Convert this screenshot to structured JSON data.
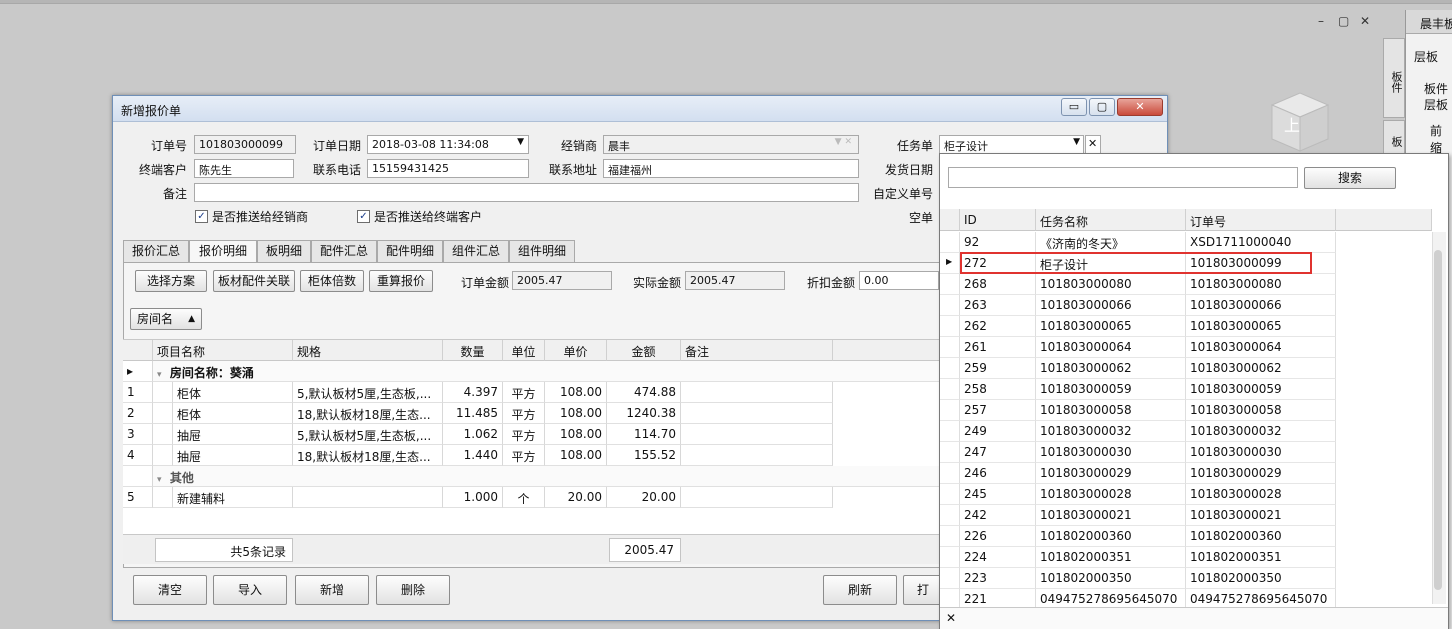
{
  "app": {
    "controls": {
      "min": "–",
      "max": "▢",
      "close": "✕"
    },
    "side_tab_1": "板件",
    "side_tab_2": "板",
    "right_panel": {
      "title": "晨丰板",
      "tab": "层板",
      "l1": "板件",
      "l2": "层板",
      "l3": "前缩"
    },
    "cube_label": "上"
  },
  "window": {
    "title": "新增报价单",
    "controls": {
      "min": "▭",
      "max": "▢",
      "close": "✕"
    },
    "form": {
      "order_no_label": "订单号",
      "order_no": "101803000099",
      "order_date_label": "订单日期",
      "order_date": "2018-03-08 11:34:08",
      "dealer_label": "经销商",
      "dealer": "晨丰",
      "task_label": "任务单",
      "task": "柜子设计",
      "customer_label": "终端客户",
      "customer": "陈先生",
      "phone_label": "联系电话",
      "phone": "15159431425",
      "address_label": "联系地址",
      "address": "福建福州",
      "ship_date_label": "发货日期",
      "remark_label": "备注",
      "remark": "",
      "custom_no_label": "自定义单号",
      "push_dealer": "是否推送给经销商",
      "push_customer": "是否推送给终端客户",
      "empty_label": "空单"
    },
    "tabs": [
      "报价汇总",
      "报价明细",
      "板明细",
      "配件汇总",
      "配件明细",
      "组件汇总",
      "组件明细"
    ],
    "toolbar": {
      "select_plan": "选择方案",
      "board_link": "板材配件关联",
      "cabinet_mult": "柜体倍数",
      "recalc": "重算报价",
      "order_amount_label": "订单金额",
      "order_amount": "2005.47",
      "actual_amount_label": "实际金额",
      "actual_amount": "2005.47",
      "discount_label": "折扣金额",
      "discount": "0.00"
    },
    "group_by": "房间名",
    "grid": {
      "headers": [
        "项目名称",
        "规格",
        "数量",
        "单位",
        "单价",
        "金额",
        "备注"
      ],
      "group1": "房间名称：葵涌",
      "group2": "其他",
      "rows": [
        {
          "n": "1",
          "name": "柜体",
          "spec": "5,默认板材5厘,生态板,...",
          "qty": "4.397",
          "unit": "平方",
          "price": "108.00",
          "amt": "474.88"
        },
        {
          "n": "2",
          "name": "柜体",
          "spec": "18,默认板材18厘,生态...",
          "qty": "11.485",
          "unit": "平方",
          "price": "108.00",
          "amt": "1240.38"
        },
        {
          "n": "3",
          "name": "抽屉",
          "spec": "5,默认板材5厘,生态板,...",
          "qty": "1.062",
          "unit": "平方",
          "price": "108.00",
          "amt": "114.70"
        },
        {
          "n": "4",
          "name": "抽屉",
          "spec": "18,默认板材18厘,生态...",
          "qty": "1.440",
          "unit": "平方",
          "price": "108.00",
          "amt": "155.52"
        },
        {
          "n": "5",
          "name": "新建辅料",
          "spec": "",
          "qty": "1.000",
          "unit": "个",
          "price": "20.00",
          "amt": "20.00"
        }
      ],
      "footer_count": "共5条记录",
      "footer_total": "2005.47"
    },
    "bottom": {
      "clear": "清空",
      "import": "导入",
      "add": "新增",
      "delete": "删除",
      "refresh": "刷新",
      "print": "打"
    }
  },
  "popup": {
    "search_value": "",
    "search_btn": "搜索",
    "headers": [
      "ID",
      "任务名称",
      "订单号"
    ],
    "rows": [
      [
        "92",
        "《济南的冬天》",
        "XSD1711000040"
      ],
      [
        "272",
        "柜子设计",
        "101803000099"
      ],
      [
        "268",
        "101803000080",
        "101803000080"
      ],
      [
        "263",
        "101803000066",
        "101803000066"
      ],
      [
        "262",
        "101803000065",
        "101803000065"
      ],
      [
        "261",
        "101803000064",
        "101803000064"
      ],
      [
        "259",
        "101803000062",
        "101803000062"
      ],
      [
        "258",
        "101803000059",
        "101803000059"
      ],
      [
        "257",
        "101803000058",
        "101803000058"
      ],
      [
        "249",
        "101803000032",
        "101803000032"
      ],
      [
        "247",
        "101803000030",
        "101803000030"
      ],
      [
        "246",
        "101803000029",
        "101803000029"
      ],
      [
        "245",
        "101803000028",
        "101803000028"
      ],
      [
        "242",
        "101803000021",
        "101803000021"
      ],
      [
        "226",
        "101802000360",
        "101802000360"
      ],
      [
        "224",
        "101802000351",
        "101802000351"
      ],
      [
        "223",
        "101802000350",
        "101802000350"
      ],
      [
        "221",
        "049475278695645070",
        "049475278695645070"
      ]
    ],
    "close": "✕"
  }
}
